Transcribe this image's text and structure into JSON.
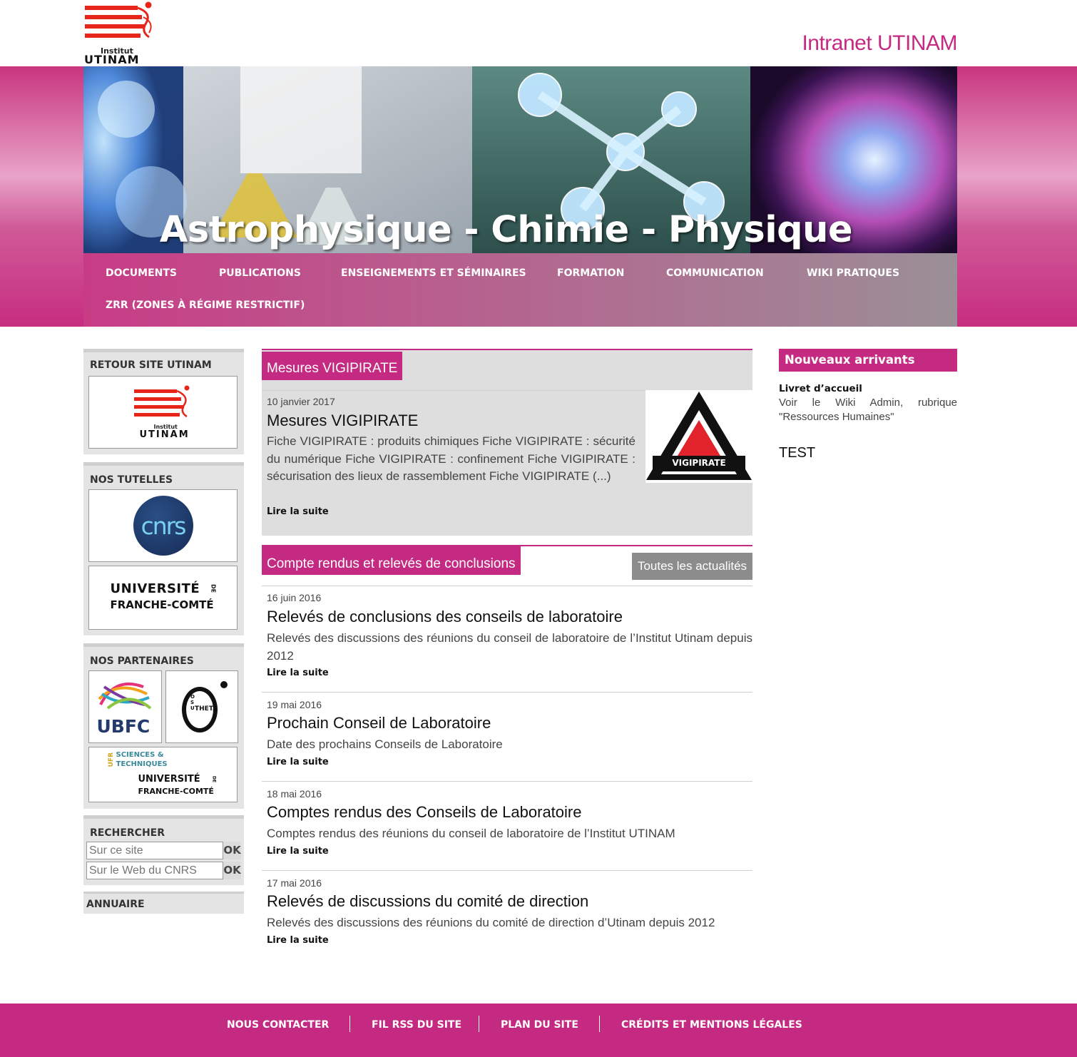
{
  "header": {
    "logo_text_top": "Institut",
    "logo_text_main": "UTINAM",
    "site_title": "Intranet UTINAM"
  },
  "banner": {
    "title": "Astrophysique - Chimie - Physique"
  },
  "nav": {
    "items": [
      {
        "label": "DOCUMENTS"
      },
      {
        "label": "PUBLICATIONS"
      },
      {
        "label": "ENSEIGNEMENTS ET SÉMINAIRES"
      },
      {
        "label": "FORMATION"
      },
      {
        "label": "COMMUNICATION"
      },
      {
        "label": "WIKI PRATIQUES"
      },
      {
        "label": "ZRR (ZONES À RÉGIME RESTRICTIF)"
      }
    ]
  },
  "sidebar": {
    "retour_title": "RETOUR SITE UTINAM",
    "tutelles_title": "NOS TUTELLES",
    "cnrs_logo": "cnrs",
    "ufc_logo_line1": "UNIVERSITÉ",
    "ufc_logo_de": "DE",
    "ufc_logo_line2": "FRANCHE-COMTÉ",
    "partenaires_title": "NOS PARTENAIRES",
    "ubfc_logo": "UBFC",
    "theta_logo": "THETA",
    "theta_letters": "O S U",
    "ufr_logo_ufr": "UFR",
    "ufr_logo_line1": "SCIENCES &",
    "ufr_logo_line2": "TECHNIQUES",
    "rechercher_title": "RECHERCHER",
    "search_site_placeholder": "Sur ce site",
    "search_cnrs_placeholder": "Sur le Web du CNRS",
    "ok_label": "OK",
    "annuaire_title": "ANNUAIRE"
  },
  "vigipirate": {
    "tab": "Mesures VIGIPIRATE",
    "date": "10 janvier 2017",
    "title": "Mesures VIGIPIRATE",
    "text": "Fiche VIGIPIRATE : produits chimiques Fiche VIGIPIRATE : sécurité du numérique Fiche VIGIPIRATE : confinement Fiche VIGIPIRATE : sécurisation des lieux de rassemblement Fiche VIGIPIRATE (...)",
    "more": "Lire la suite",
    "logo_label": "VIGIPIRATE"
  },
  "comptes": {
    "tab": "Compte rendus et relevés de conclusions",
    "all_news": "Toutes les actualités",
    "articles": [
      {
        "date": "16 juin 2016",
        "title": "Relevés de conclusions des conseils de laboratoire",
        "text": "Relevés des discussions des réunions du conseil de laboratoire de l’Institut Utinam depuis 2012",
        "more": "Lire la suite"
      },
      {
        "date": "19 mai 2016",
        "title": "Prochain Conseil de Laboratoire",
        "text": "Date des prochains Conseils de Laboratoire",
        "more": "Lire la suite"
      },
      {
        "date": "18 mai 2016",
        "title": "Comptes rendus des Conseils de Laboratoire",
        "text": "Comptes rendus des réunions du conseil de laboratoire de l’Institut UTINAM",
        "more": "Lire la suite"
      },
      {
        "date": "17 mai 2016",
        "title": "Relevés de discussions du comité de direction",
        "text": "Relevés des discussions des réunions du comité de direction d’Utinam depuis 2012",
        "more": "Lire la suite"
      }
    ]
  },
  "right": {
    "head": "Nouveaux arrivants",
    "livret_title": "Livret d’accueil",
    "livret_text": "Voir le Wiki Admin, rubrique \"Ressources Humaines\"",
    "test": "TEST"
  },
  "footer": {
    "items": [
      {
        "label": "NOUS CONTACTER"
      },
      {
        "label": "FIL RSS DU SITE"
      },
      {
        "label": "PLAN DU SITE"
      },
      {
        "label": "CRÉDITS ET MENTIONS LÉGALES"
      }
    ]
  },
  "colors": {
    "brand_pink": "#c42a82",
    "logo_red": "#e8251b"
  }
}
